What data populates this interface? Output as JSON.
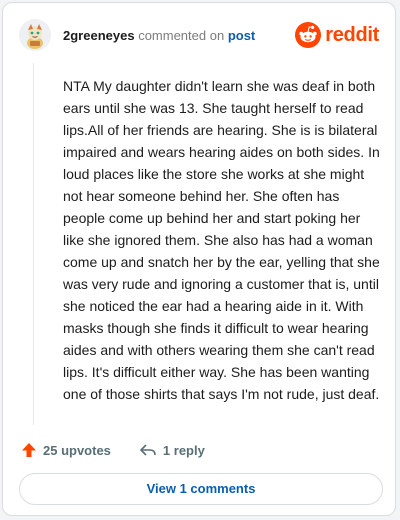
{
  "comment": {
    "username": "2greeneyes",
    "action_text": "commented on",
    "post_link": "post",
    "body": "NTA My daughter didn't learn she was deaf in both ears until she was 13. She taught herself to read lips.All of her friends are hearing. She is is bilateral impaired and wears hearing aides on both sides. In loud places like the store she works at she might not hear someone behind her. She often has people come up behind her and start poking her like she ignored them. She also has had a woman come up and snatch her by the ear, yelling that she was very rude and ignoring a customer that is, until she noticed the ear had a hearing aide in it. With masks though she finds it difficult to wear hearing aides and with others wearing them she can't read lips. It's difficult either way. She has been wanting one of those shirts that says I'm not rude, just deaf."
  },
  "brand": {
    "wordmark": "reddit",
    "icon": "reddit-snoo-icon",
    "color": "#ff4500"
  },
  "actions": {
    "upvotes_label": "25 upvotes",
    "upvote_icon": "upvote-arrow-icon",
    "reply_label": "1 reply",
    "reply_icon": "reply-arrow-icon"
  },
  "footer": {
    "view_comments_label": "View 1 comments"
  },
  "colors": {
    "link": "#0a5eb0",
    "upvote": "#ff4500",
    "muted": "#576f76"
  }
}
